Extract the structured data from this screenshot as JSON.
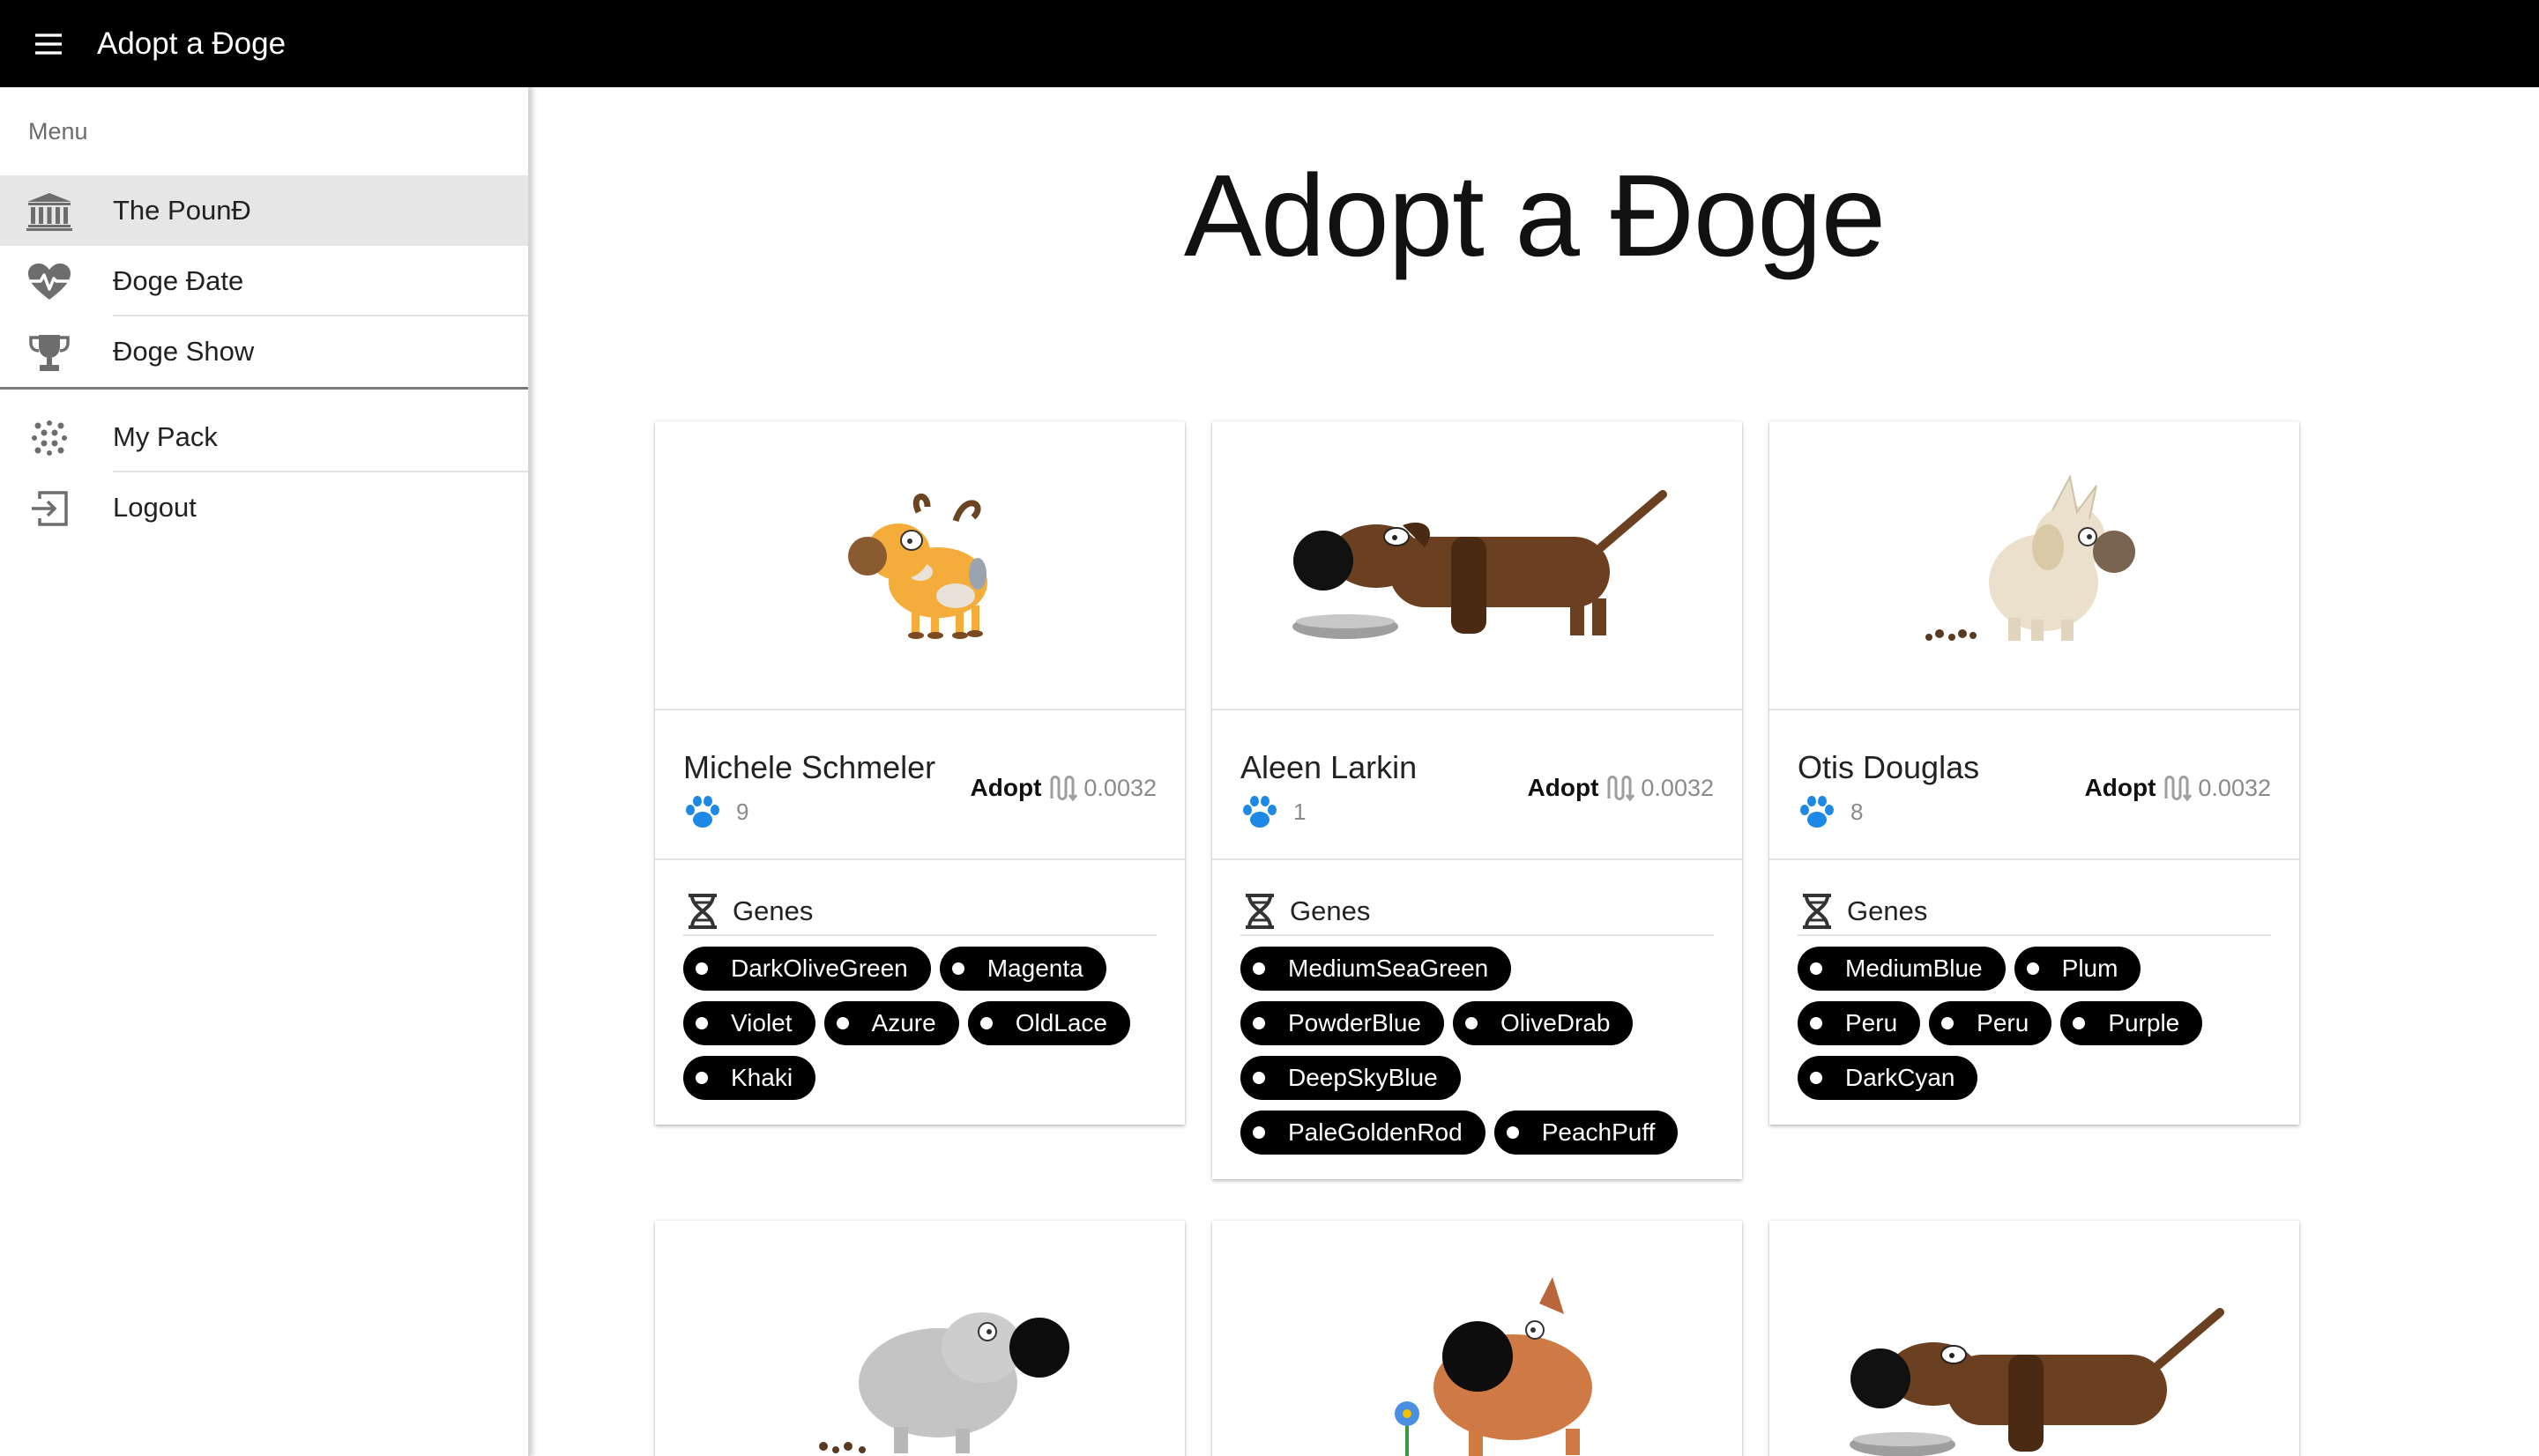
{
  "app": {
    "title": "Adopt a Đoge"
  },
  "drawer": {
    "subheader": "Menu",
    "items": [
      {
        "label": "The PounĐ",
        "icon": "bank-icon",
        "active": true
      },
      {
        "label": "Đoge Đate",
        "icon": "heart-pulse-icon",
        "active": false
      },
      {
        "label": "Đoge Show",
        "icon": "trophy-icon",
        "active": false
      },
      {
        "label": "My Pack",
        "icon": "dots-grid-icon",
        "active": false
      },
      {
        "label": "Logout",
        "icon": "logout-icon",
        "active": false
      }
    ]
  },
  "main": {
    "title": "Adopt a Đoge",
    "cards": [
      {
        "name": "Michele Schmeler",
        "generation": "9",
        "adopt_label": "Adopt",
        "price": "0.0032",
        "genes_title": "Genes",
        "genes": [
          "DarkOliveGreen",
          "Magenta",
          "Violet",
          "Azure",
          "OldLace",
          "Khaki"
        ],
        "image": "orange-spotted-dog"
      },
      {
        "name": "Aleen Larkin",
        "generation": "1",
        "adopt_label": "Adopt",
        "price": "0.0032",
        "genes_title": "Genes",
        "genes": [
          "MediumSeaGreen",
          "PowderBlue",
          "OliveDrab",
          "DeepSkyBlue",
          "PaleGoldenRod",
          "PeachPuff"
        ],
        "image": "brown-dachshund-with-bowl"
      },
      {
        "name": "Otis Douglas",
        "generation": "8",
        "adopt_label": "Adopt",
        "price": "0.0032",
        "genes_title": "Genes",
        "genes": [
          "MediumBlue",
          "Plum",
          "Peru",
          "Peru",
          "Purple",
          "DarkCyan"
        ],
        "image": "shaggy-cream-dog"
      }
    ],
    "partial_cards": [
      {
        "image": "shaggy-grey-dog"
      },
      {
        "image": "orange-bulldog-with-flower"
      },
      {
        "image": "brown-dachshund-with-bowl"
      }
    ]
  },
  "colors": {
    "appbar": "#000000",
    "paw": "#1e88e5",
    "chip": "#000000",
    "active_item": "#e6e6e6"
  }
}
